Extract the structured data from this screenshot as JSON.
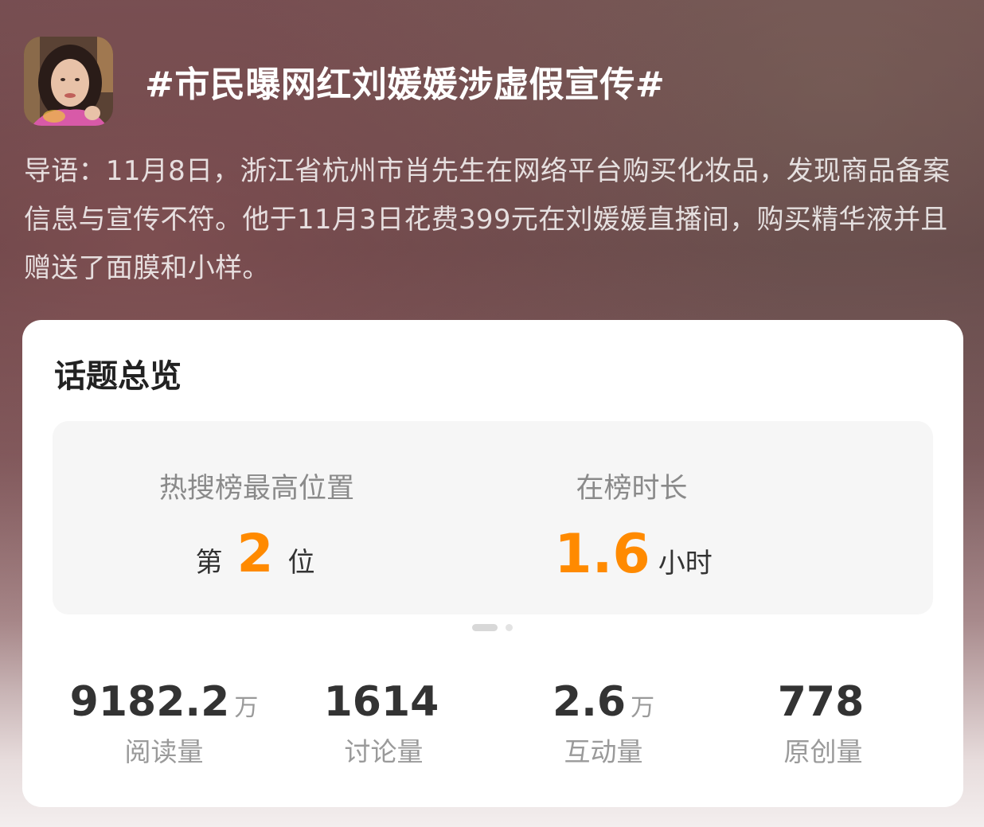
{
  "topic": {
    "title": "#市民曝网红刘媛媛涉虚假宣传#",
    "avatar_icon": "user-avatar"
  },
  "intro": {
    "text": "导语：11月8日，浙江省杭州市肖先生在网络平台购买化妆品，发现商品备案信息与宣传不符。他于11月3日花费399元在刘媛媛直播间，购买精华液并且赠送了面膜和小样。"
  },
  "overview": {
    "title": "话题总览",
    "rank": {
      "label": "热搜榜最高位置",
      "prefix": "第",
      "value": "2",
      "suffix": "位"
    },
    "duration": {
      "label": "在榜时长",
      "value": "1.6",
      "unit": "小时"
    },
    "pager": {
      "pages": 2,
      "current": 1
    },
    "stats": [
      {
        "value": "9182.2",
        "unit": "万",
        "label": "阅读量"
      },
      {
        "value": "1614",
        "unit": "",
        "label": "讨论量"
      },
      {
        "value": "2.6",
        "unit": "万",
        "label": "互动量"
      },
      {
        "value": "778",
        "unit": "",
        "label": "原创量"
      }
    ]
  },
  "colors": {
    "accent": "#ff8a00",
    "card_bg": "#ffffff",
    "panel_bg": "#f6f6f6"
  }
}
